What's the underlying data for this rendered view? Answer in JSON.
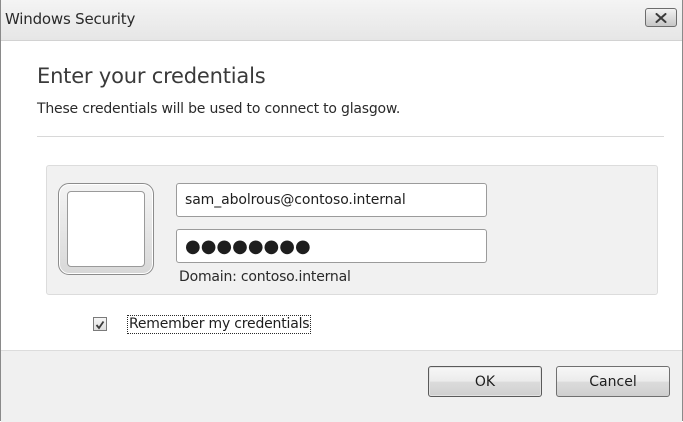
{
  "window": {
    "title": "Windows Security",
    "close_icon": "close-icon"
  },
  "prompt": {
    "heading": "Enter your credentials",
    "description": "These credentials will be used to connect to glasgow."
  },
  "credentials": {
    "tile_icon": "user-tile-icon",
    "username_value": "sam_abolrous@contoso.internal",
    "password_masked": "●●●●●●●●",
    "domain_text": "Domain: contoso.internal"
  },
  "remember": {
    "label": "Remember my credentials",
    "checked": true
  },
  "buttons": {
    "ok_label": "OK",
    "cancel_label": "Cancel"
  },
  "colors": {
    "panel_background": "#f1f1f1",
    "footer_background": "#f0f0f0"
  }
}
